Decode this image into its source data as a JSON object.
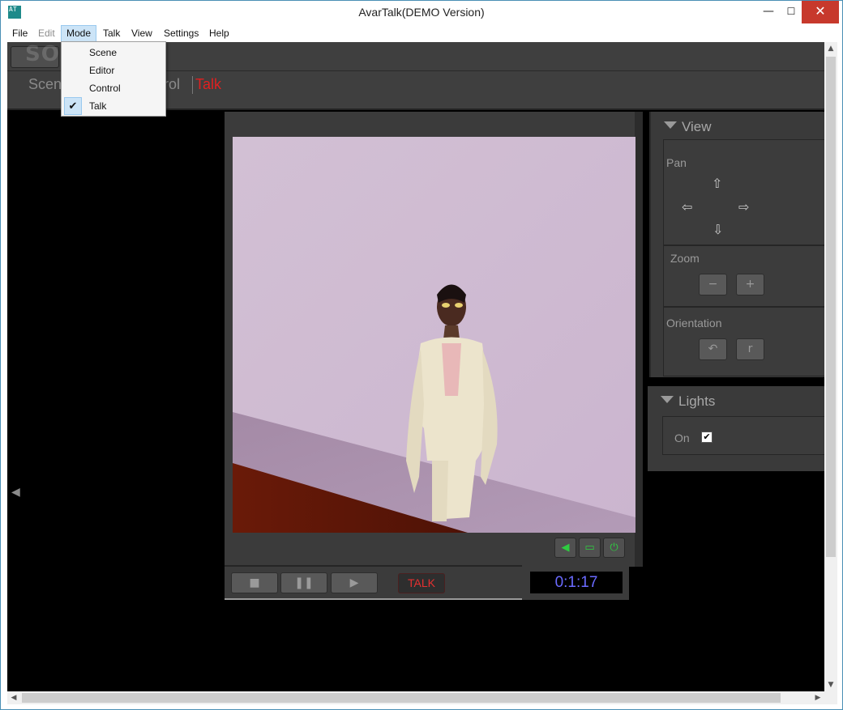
{
  "window": {
    "title": "AvarTalk(DEMO Version)",
    "icon_text": "AT",
    "minimize": "—",
    "maximize": "☐",
    "close": "✕"
  },
  "menubar": {
    "items": [
      {
        "label": "File",
        "disabled": false
      },
      {
        "label": "Edit",
        "disabled": true
      },
      {
        "label": "Mode",
        "disabled": false,
        "active": true
      },
      {
        "label": "Talk",
        "disabled": false
      },
      {
        "label": "View",
        "disabled": false
      },
      {
        "label": "Settings",
        "disabled": false
      },
      {
        "label": "Help",
        "disabled": false
      }
    ]
  },
  "mode_menu": {
    "items": [
      "Scene",
      "Editor",
      "Control",
      "Talk"
    ],
    "checked": "Talk",
    "check_glyph": "✔"
  },
  "watermark": "SOFTPEDIA",
  "tabs": {
    "scene": "Scen",
    "control": "rol",
    "talk": "Talk"
  },
  "player": {
    "talk_label": "TALK",
    "time": "0:1:17",
    "stop": "■",
    "pause": "❚❚",
    "play": "▶",
    "controls": [
      "speaker-icon",
      "screen-icon",
      "power-icon"
    ]
  },
  "view_panel": {
    "title": "View",
    "pan_label": "Pan",
    "pan_up": "⇧",
    "pan_down": "⇩",
    "pan_left": "⇦",
    "pan_right": "⇨",
    "zoom_label": "Zoom",
    "zoom_out": "−",
    "zoom_in": "+",
    "orientation_label": "Orientation",
    "rotate_left": "↶",
    "rotate_right": "r"
  },
  "lights_panel": {
    "title": "Lights",
    "on_label": "On",
    "on_checked": true,
    "check_glyph": "✔"
  },
  "colors": {
    "accent_red": "#e02020",
    "timer_blue": "#6a6aff",
    "panel_bg": "#3a3a3a",
    "control_green": "#2ecc40"
  }
}
